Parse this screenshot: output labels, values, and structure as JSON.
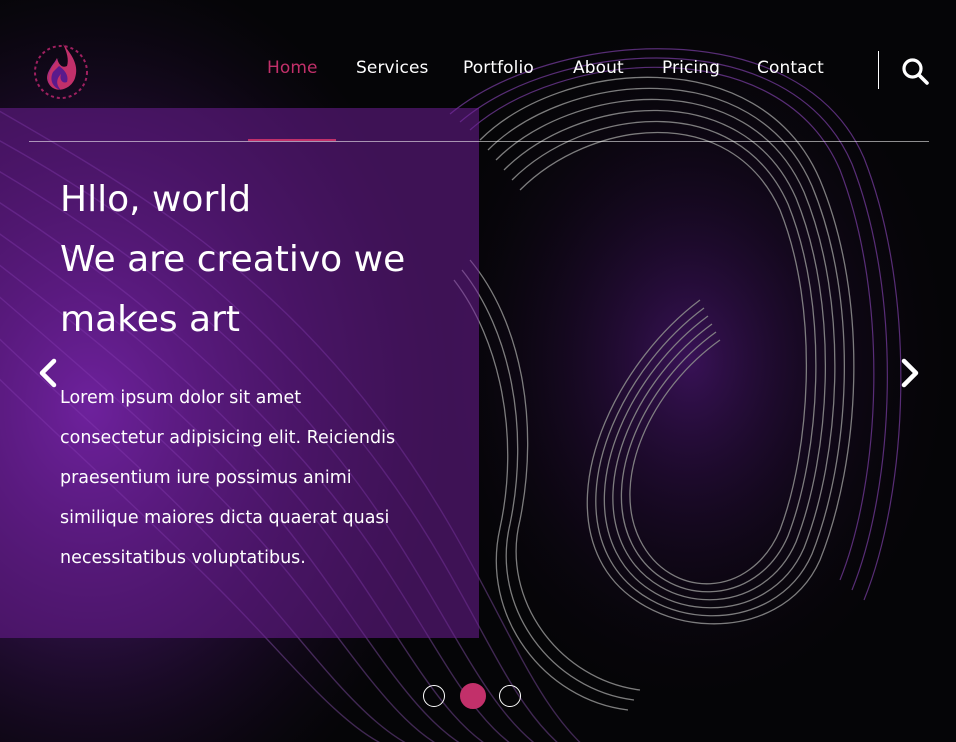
{
  "nav": {
    "items": [
      {
        "label": "Home",
        "active": true
      },
      {
        "label": "Services",
        "active": false
      },
      {
        "label": "Portfolio",
        "active": false
      },
      {
        "label": "About",
        "active": false
      },
      {
        "label": "Pricing",
        "active": false
      },
      {
        "label": "Contact",
        "active": false
      }
    ],
    "search_icon": "search-icon"
  },
  "hero": {
    "title_lines": [
      "Hllo, world",
      "We are creativo we",
      "makes art"
    ],
    "text_lines": [
      "Lorem ipsum dolor sit amet",
      "consectetur adipisicing elit. Reiciendis",
      "praesentium iure possimus animi",
      "similique maiores dicta quaerat quasi",
      "necessitatibus voluptatibus."
    ]
  },
  "slider": {
    "prev_icon": "chevron-left-icon",
    "next_icon": "chevron-right-icon",
    "slide_count": 3,
    "active_slide": 2
  },
  "colors": {
    "accent": "#c2306a",
    "panel": "#6e1e96",
    "background": "#050507"
  }
}
